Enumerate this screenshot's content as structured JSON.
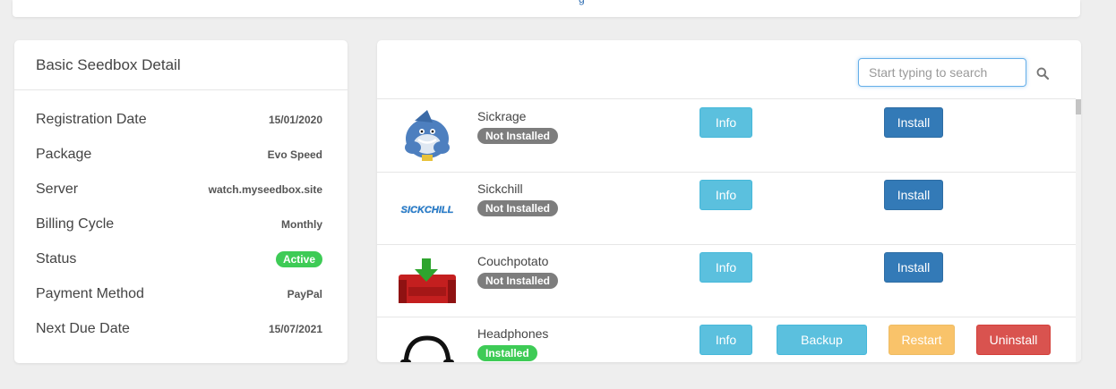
{
  "detail": {
    "title": "Basic Seedbox Detail",
    "rows": [
      {
        "label": "Registration Date",
        "value": "15/01/2020"
      },
      {
        "label": "Package",
        "value": "Evo Speed"
      },
      {
        "label": "Server",
        "value": "watch.myseedbox.site"
      },
      {
        "label": "Billing Cycle",
        "value": "Monthly"
      },
      {
        "label": "Status",
        "value": "Active"
      },
      {
        "label": "Payment Method",
        "value": "PayPal"
      },
      {
        "label": "Next Due Date",
        "value": "15/07/2021"
      }
    ]
  },
  "search": {
    "placeholder": "Start typing to search",
    "value": ""
  },
  "apps": [
    {
      "name": "Sickrage",
      "status": "Not Installed",
      "actions": [
        "Info",
        "Install"
      ],
      "logo_text": ""
    },
    {
      "name": "Sickchill",
      "status": "Not Installed",
      "actions": [
        "Info",
        "Install"
      ],
      "logo_text": "SICKCHILL"
    },
    {
      "name": "Couchpotato",
      "status": "Not Installed",
      "actions": [
        "Info",
        "Install"
      ],
      "logo_text": ""
    },
    {
      "name": "Headphones",
      "status": "Installed",
      "actions": [
        "Info",
        "Backup",
        "Restart",
        "Uninstall"
      ],
      "logo_text": ""
    }
  ],
  "colors": {
    "info": "#5bc0de",
    "install": "#337ab7",
    "restart": "#f9c36a",
    "uninstall": "#d9534f",
    "active": "#3ecb56",
    "not_installed": "#7d7d7d"
  },
  "icons": [
    "search-icon",
    "shark-logo-icon",
    "sickchill-logo-icon",
    "couch-logo-icon",
    "headphones-logo-icon"
  ]
}
